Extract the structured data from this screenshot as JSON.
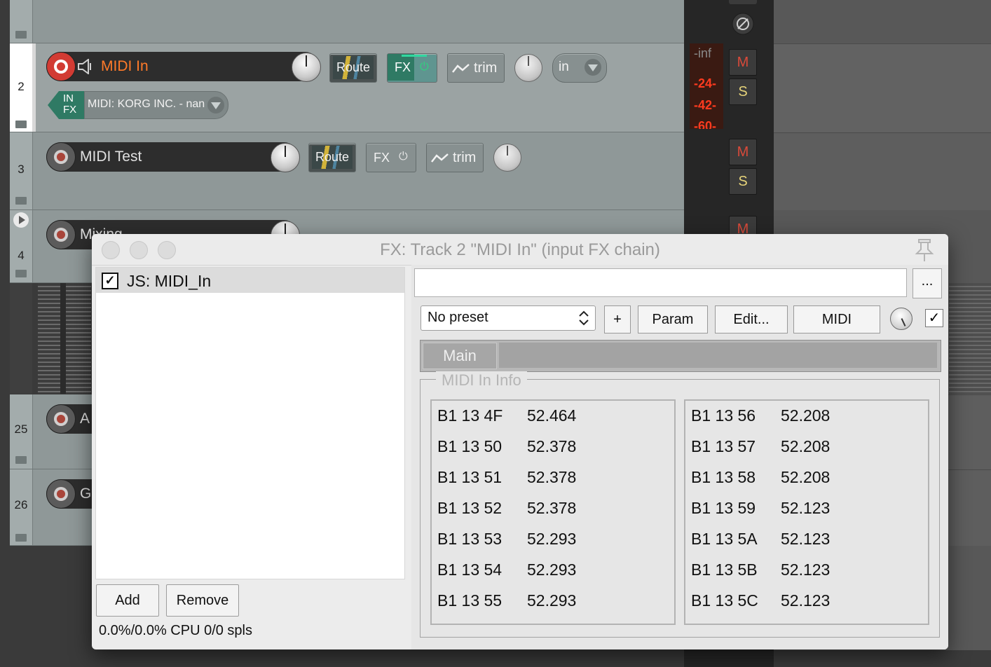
{
  "tracks": [
    {
      "number": "",
      "name": "",
      "hidden_name": true
    },
    {
      "number": "2",
      "name": "MIDI In",
      "armed": true,
      "route_label": "Route",
      "fx_label": "FX",
      "trim_label": "trim",
      "input_label": "in",
      "input_device": "MIDI: KORG INC. - nan",
      "in_fx_label_top": "IN",
      "in_fx_label_bottom": "FX"
    },
    {
      "number": "3",
      "name": "MIDI Test",
      "route_label": "Route",
      "fx_label": "FX",
      "trim_label": "trim"
    },
    {
      "number": "4",
      "name": "Mixing"
    },
    {
      "number": "25",
      "name": "A"
    },
    {
      "number": "26",
      "name": "G"
    }
  ],
  "meter": {
    "peak_label": "-inf",
    "scale": [
      "-24-",
      "-42-",
      "-60-"
    ],
    "mute_label": "M",
    "solo_label": "S",
    "phase_icon": "phase-invert-icon"
  },
  "fx_window": {
    "title": "FX: Track 2 \"MIDI In\" (input FX chain)",
    "plugins": [
      {
        "name": "JS: MIDI_In",
        "enabled": true
      }
    ],
    "add_label": "Add",
    "remove_label": "Remove",
    "cpu_text": "0.0%/0.0% CPU 0/0 spls",
    "search_value": "",
    "more_label": "...",
    "preset_value": "No preset",
    "plus_label": "+",
    "param_label": "Param",
    "edit_label": "Edit...",
    "midi_label": "MIDI",
    "bypass_checked": true,
    "tab_main": "Main",
    "info_title": "MIDI In Info",
    "info_left": [
      {
        "code": "B1 13 4F",
        "value": "52.464"
      },
      {
        "code": "B1 13 50",
        "value": "52.378"
      },
      {
        "code": "B1 13 51",
        "value": "52.378"
      },
      {
        "code": "B1 13 52",
        "value": "52.378"
      },
      {
        "code": "B1 13 53",
        "value": "52.293"
      },
      {
        "code": "B1 13 54",
        "value": "52.293"
      },
      {
        "code": "B1 13 55",
        "value": "52.293"
      }
    ],
    "info_right": [
      {
        "code": "B1 13 56",
        "value": "52.208"
      },
      {
        "code": "B1 13 57",
        "value": "52.208"
      },
      {
        "code": "B1 13 58",
        "value": "52.208"
      },
      {
        "code": "B1 13 59",
        "value": "52.123"
      },
      {
        "code": "B1 13 5A",
        "value": "52.123"
      },
      {
        "code": "B1 13 5B",
        "value": "52.123"
      },
      {
        "code": "B1 13 5C",
        "value": "52.123"
      }
    ]
  },
  "colors": {
    "accent": "#ff7a29",
    "record": "#d23b33",
    "mute": "#d94a3a",
    "solo": "#e6d37a",
    "meter_text": "#ff3b1f"
  }
}
